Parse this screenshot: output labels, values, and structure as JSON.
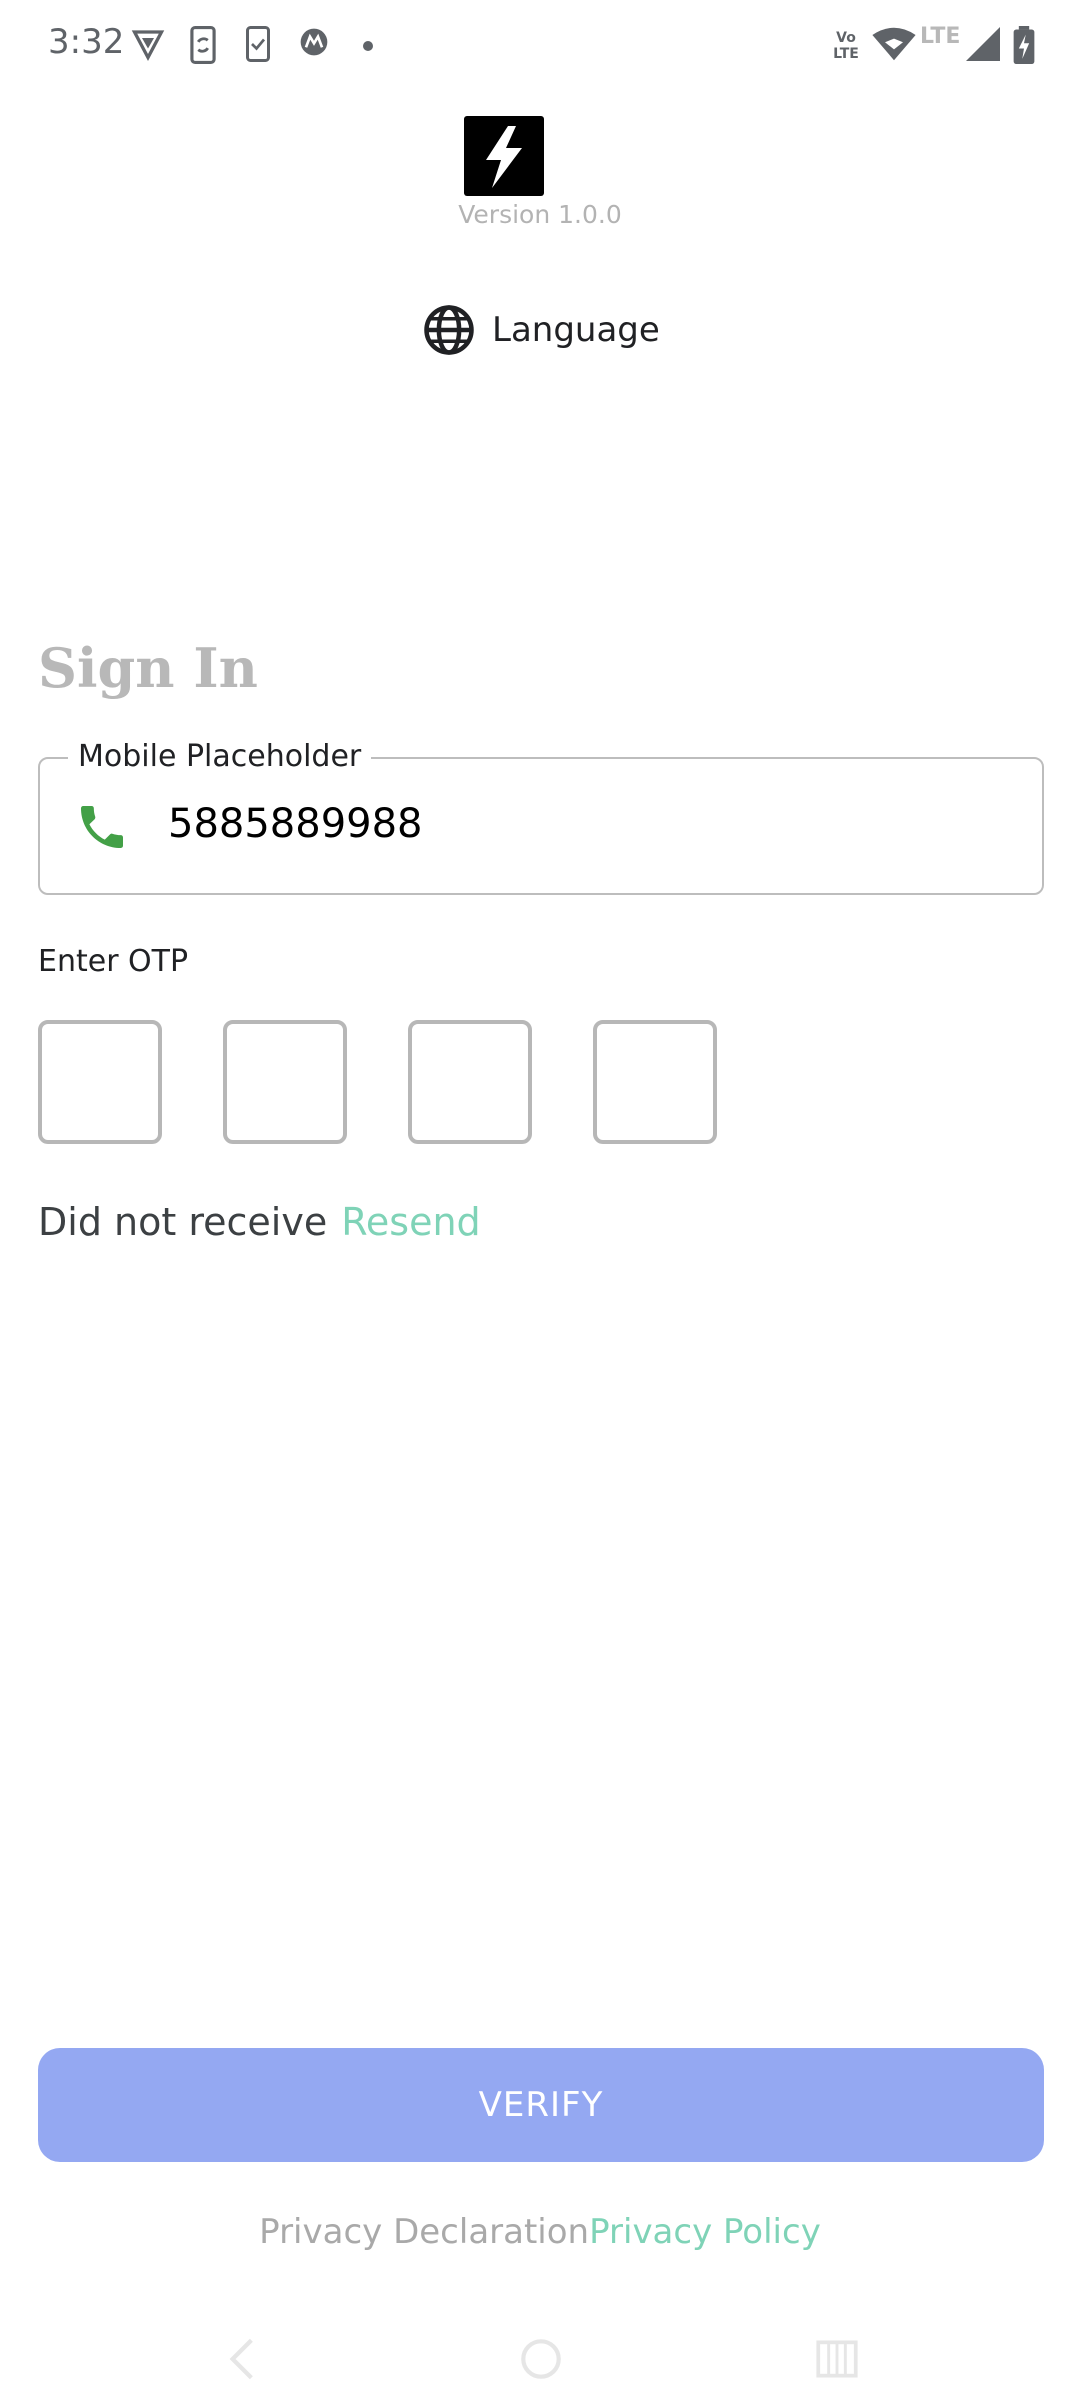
{
  "status_bar": {
    "time": "3:32",
    "icons_left": [
      "vpn-shield-icon",
      "phone-sync-icon",
      "phone-check-icon",
      "motorola-icon",
      "dot-icon"
    ],
    "icons_right": [
      "volte-icon",
      "wifi-icon",
      "lte-icon",
      "signal-icon",
      "battery-charging-icon"
    ],
    "volte_text": "Vo LTE",
    "lte_text": "LTE"
  },
  "app": {
    "logo_icon": "lightning-bolt-icon",
    "version": "Version 1.0.0",
    "language_label": "Language"
  },
  "signin": {
    "title": "Sign In",
    "mobile_label": "Mobile Placeholder",
    "mobile_value": "5885889988",
    "otp_label": "Enter OTP",
    "otp_values": [
      "",
      "",
      "",
      ""
    ],
    "did_not_receive": "Did not receive",
    "resend": "Resend",
    "verify": "VERIFY"
  },
  "footer": {
    "privacy_declaration": "Privacy Declaration",
    "privacy_policy": "Privacy Policy"
  },
  "colors": {
    "accent_green": "#7fd3b7",
    "phone_icon_green": "#43a047",
    "verify_button": "#94a8f2",
    "title_gray": "#b8b8b8"
  }
}
